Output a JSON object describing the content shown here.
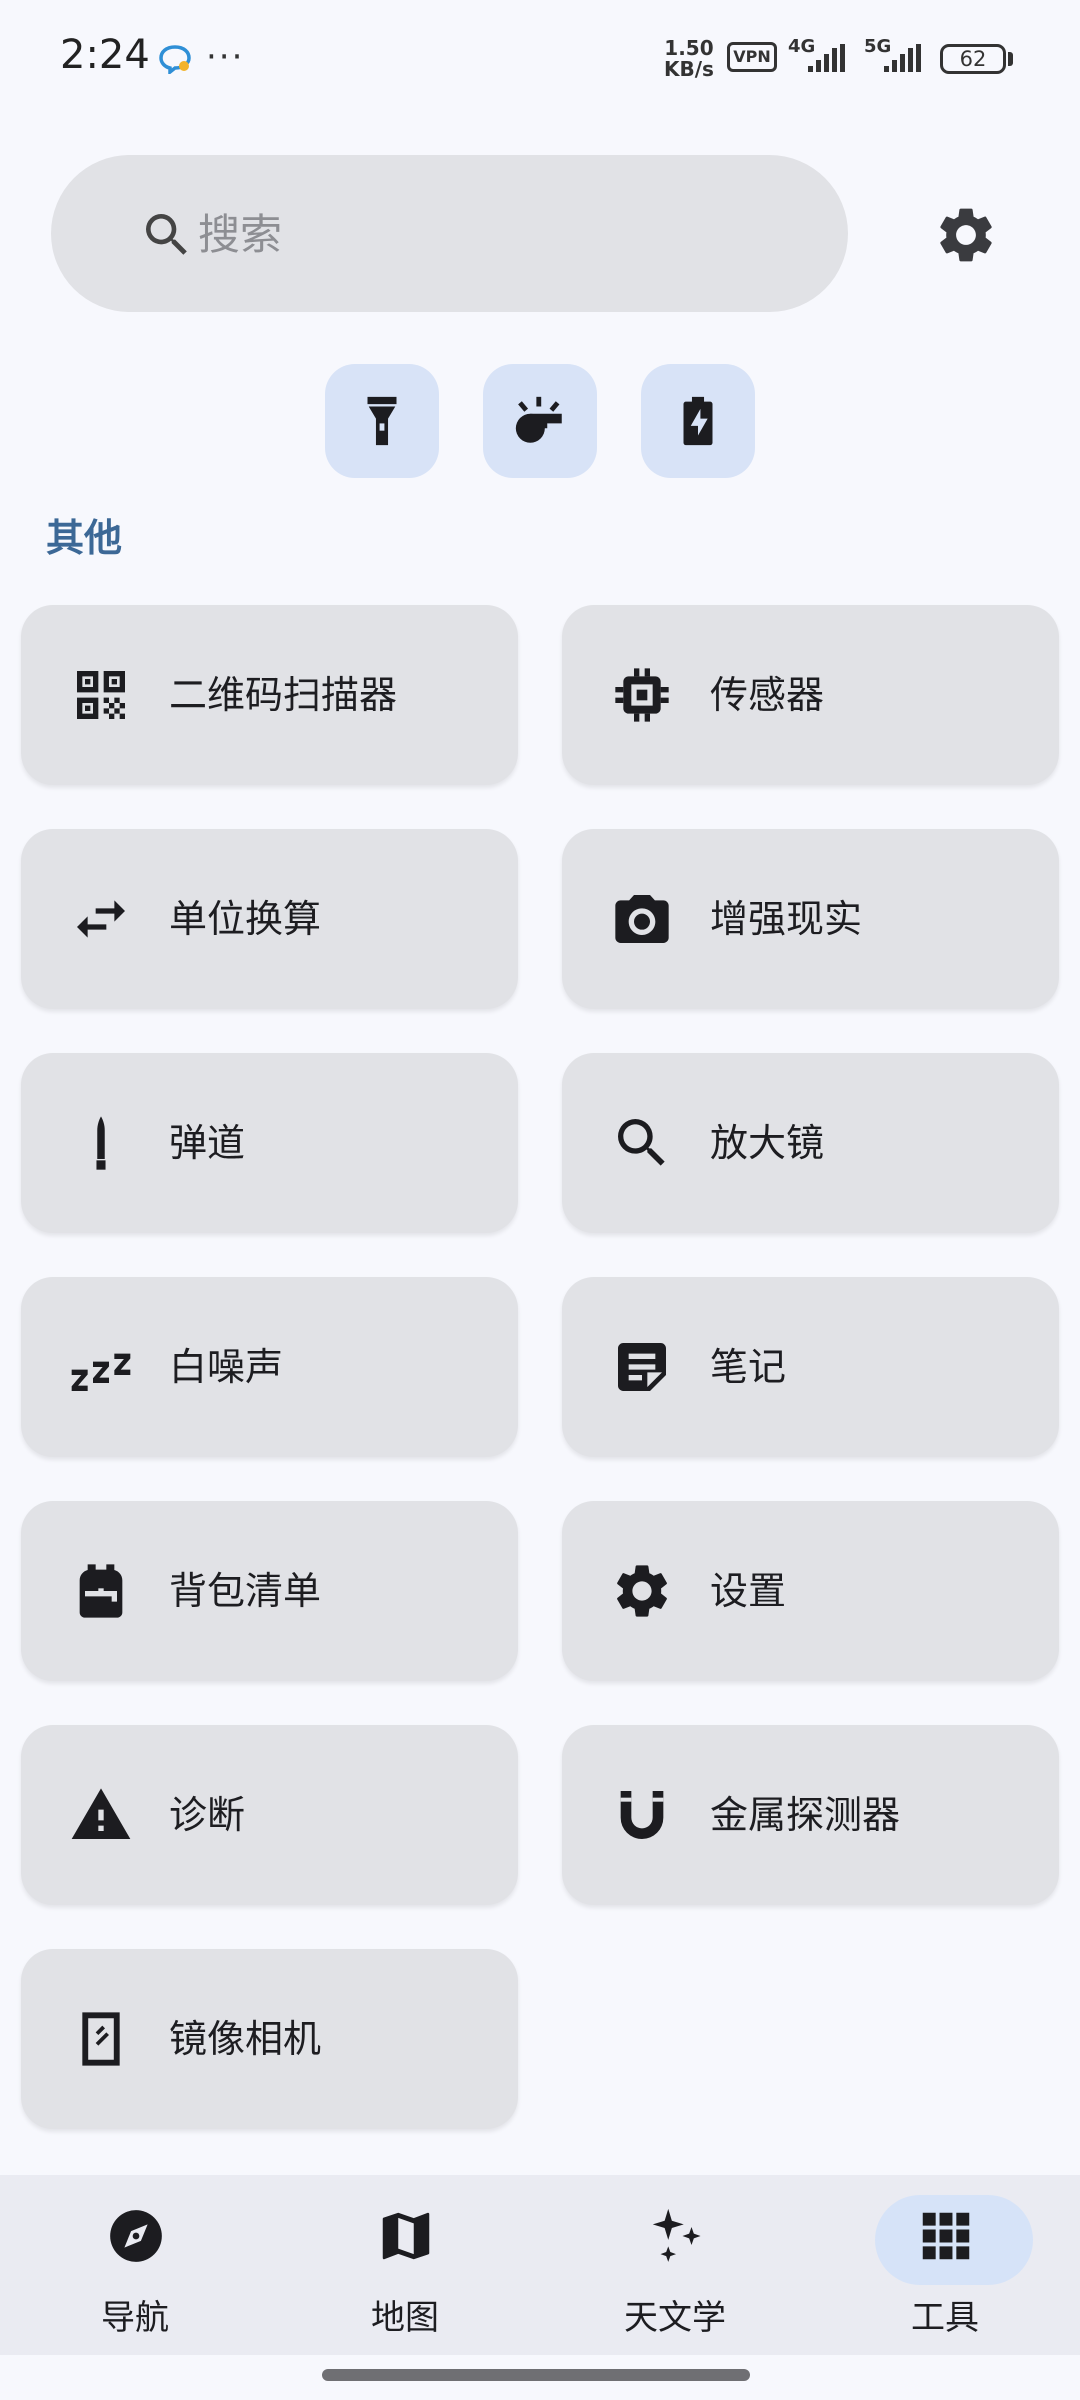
{
  "status_bar": {
    "time": "2:24",
    "speed_value": "1.50",
    "speed_unit": "KB/s",
    "vpn": "VPN",
    "net1": "4G",
    "net2": "5G",
    "battery": "62"
  },
  "search": {
    "placeholder": "搜索"
  },
  "section": {
    "title": "其他"
  },
  "tools": [
    {
      "label": "二维码扫描器",
      "icon": "qr-code-icon"
    },
    {
      "label": "传感器",
      "icon": "chip-icon"
    },
    {
      "label": "单位换算",
      "icon": "swap-arrows-icon"
    },
    {
      "label": "增强现实",
      "icon": "camera-icon"
    },
    {
      "label": "弹道",
      "icon": "bullet-icon"
    },
    {
      "label": "放大镜",
      "icon": "magnifier-icon"
    },
    {
      "label": "白噪声",
      "icon": "zzz-icon"
    },
    {
      "label": "笔记",
      "icon": "note-icon"
    },
    {
      "label": "背包清单",
      "icon": "backpack-icon"
    },
    {
      "label": "设置",
      "icon": "gear-icon"
    },
    {
      "label": "诊断",
      "icon": "warning-icon"
    },
    {
      "label": "金属探测器",
      "icon": "magnet-icon"
    },
    {
      "label": "镜像相机",
      "icon": "mirror-icon"
    }
  ],
  "nav": [
    {
      "label": "导航",
      "icon": "compass-icon"
    },
    {
      "label": "地图",
      "icon": "map-icon"
    },
    {
      "label": "天文学",
      "icon": "sparkle-icon"
    },
    {
      "label": "工具",
      "icon": "grid-icon"
    }
  ],
  "nav_selected": "工具",
  "colors": {
    "background": "#f7f8fd",
    "card": "#e1e2e6",
    "accent_text": "#3c6896",
    "quick_action": "#d8e3f7",
    "nav_pill": "#d6e3f8",
    "nav_background": "#eaebf2"
  }
}
